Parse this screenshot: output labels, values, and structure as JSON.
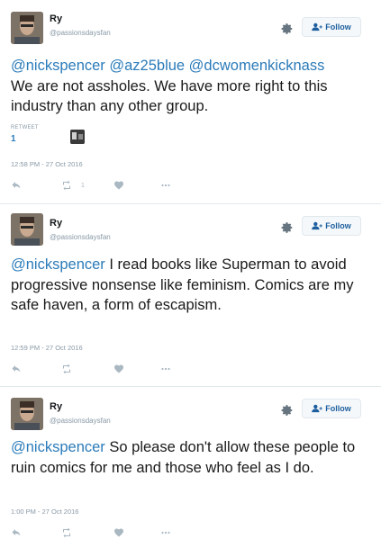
{
  "tweets": [
    {
      "name": "Ry",
      "handle": "@passionsdaysfan",
      "follow_label": "Follow",
      "mentions": "@nickspencer @az25blue @dcwomenkicknass",
      "body": "We are not assholes. We have more right to this industry than any other group.",
      "retweet_label": "RETWEET",
      "retweet_count": "1",
      "timestamp": "12:58 PM - 27 Oct 2016",
      "retweet_action_count": "1"
    },
    {
      "name": "Ry",
      "handle": "@passionsdaysfan",
      "follow_label": "Follow",
      "mentions": "@nickspencer",
      "body": "I read books like Superman to avoid progressive nonsense like feminism. Comics are my safe haven, a form of escapism.",
      "timestamp": "12:59 PM - 27 Oct 2016"
    },
    {
      "name": "Ry",
      "handle": "@passionsdaysfan",
      "follow_label": "Follow",
      "mentions": "@nickspencer",
      "body": "So please don't allow these people to ruin comics for me and those who feel as I do.",
      "timestamp": "1:00 PM - 27 Oct 2016"
    }
  ],
  "icons": {
    "settings": "gear-icon",
    "follow": "add-user-icon",
    "reply": "reply-icon",
    "retweet": "retweet-icon",
    "like": "heart-icon",
    "more": "more-dots-icon"
  },
  "colors": {
    "mention": "#2b7bb9",
    "follow_text": "#1d5f9e",
    "meta_gray": "#8899a6",
    "icon_gray": "#aab8c2"
  }
}
